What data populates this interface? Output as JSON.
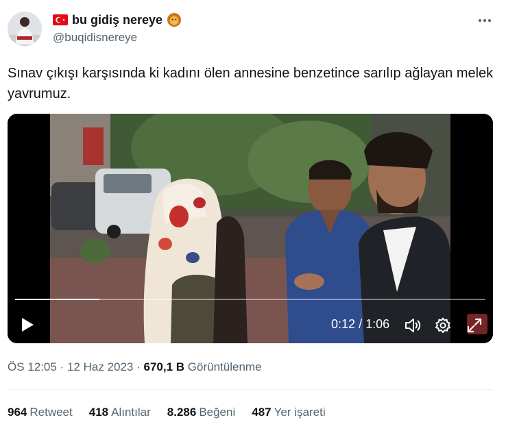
{
  "author": {
    "display_name": "bu gidiş nereye",
    "handle": "@buqidisnereye",
    "flag_icon": "turkey-flag-icon",
    "badge_icon": "lion-face-icon"
  },
  "tweet": {
    "text": "Sınav çıkışı karşısında ki kadını ölen annesine benzetince sarılıp ağlayan melek yavrumuz."
  },
  "video": {
    "current_time": "0:12",
    "separator": "/",
    "duration": "1:06",
    "progress": 0.18,
    "play_icon": "play-icon",
    "volume_icon": "volume-icon",
    "settings_icon": "gear-icon",
    "fullscreen_icon": "expand-icon"
  },
  "meta": {
    "time": "ÖS 12:05",
    "dot": "·",
    "date": "12 Haz 2023",
    "views_count": "670,1 B",
    "views_label": "Görüntülenme"
  },
  "stats": [
    {
      "count": "964",
      "label": "Retweet"
    },
    {
      "count": "418",
      "label": "Alıntılar"
    },
    {
      "count": "8.286",
      "label": "Beğeni"
    },
    {
      "count": "487",
      "label": "Yer işareti"
    }
  ],
  "colors": {
    "text_primary": "#0f1419",
    "text_secondary": "#536471",
    "divider": "#eff3f4",
    "flag_red": "#e30a17"
  }
}
